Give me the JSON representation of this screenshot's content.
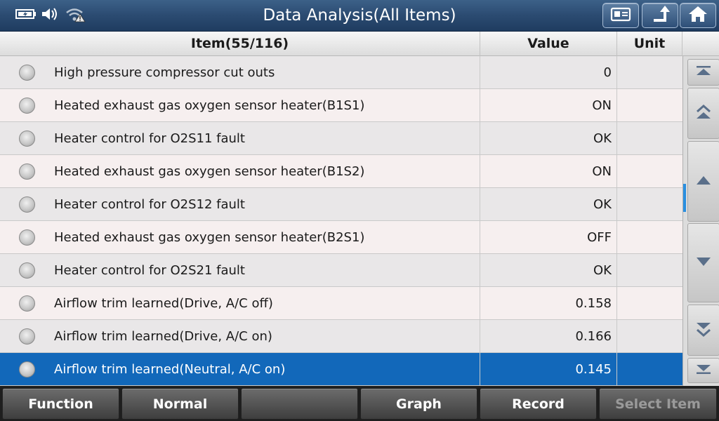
{
  "window": {
    "title": "Data Analysis(All Items)"
  },
  "status_icons": [
    "battery-icon",
    "speaker-icon",
    "wifi-warning-icon"
  ],
  "toolbar_icons": [
    "screenshot-icon",
    "back-icon",
    "home-icon"
  ],
  "table": {
    "headers": {
      "item": "Item(55/116)",
      "value": "Value",
      "unit": "Unit"
    },
    "rows": [
      {
        "item": "High pressure compressor cut outs",
        "value": "0",
        "unit": ""
      },
      {
        "item": "Heated exhaust gas oxygen sensor heater(B1S1)",
        "value": "ON",
        "unit": ""
      },
      {
        "item": "Heater control for O2S11 fault",
        "value": "OK",
        "unit": ""
      },
      {
        "item": "Heated exhaust gas oxygen sensor heater(B1S2)",
        "value": "ON",
        "unit": ""
      },
      {
        "item": "Heater control for O2S12 fault",
        "value": "OK",
        "unit": ""
      },
      {
        "item": "Heated exhaust gas oxygen sensor heater(B2S1)",
        "value": "OFF",
        "unit": ""
      },
      {
        "item": "Heater control for O2S21 fault",
        "value": "OK",
        "unit": ""
      },
      {
        "item": "Airflow trim learned(Drive, A/C off)",
        "value": "0.158",
        "unit": ""
      },
      {
        "item": "Airflow trim learned(Drive, A/C on)",
        "value": "0.166",
        "unit": ""
      },
      {
        "item": "Airflow trim learned(Neutral, A/C on)",
        "value": "0.145",
        "unit": ""
      }
    ],
    "selected_index": 9
  },
  "scrollbar_icons": [
    "scroll-top-icon",
    "page-up-icon",
    "scroll-up-icon",
    "scroll-down-icon",
    "page-down-icon",
    "scroll-bottom-icon"
  ],
  "bottombar": {
    "function_label": "Function",
    "normal_label": "Normal",
    "blank_label": "",
    "graph_label": "Graph",
    "record_label": "Record",
    "select_item_label": "Select Item"
  },
  "colors": {
    "titlebar": "#2b4b71",
    "selected_row": "#1268ba",
    "scroll_thumb": "#2a8fe0"
  }
}
